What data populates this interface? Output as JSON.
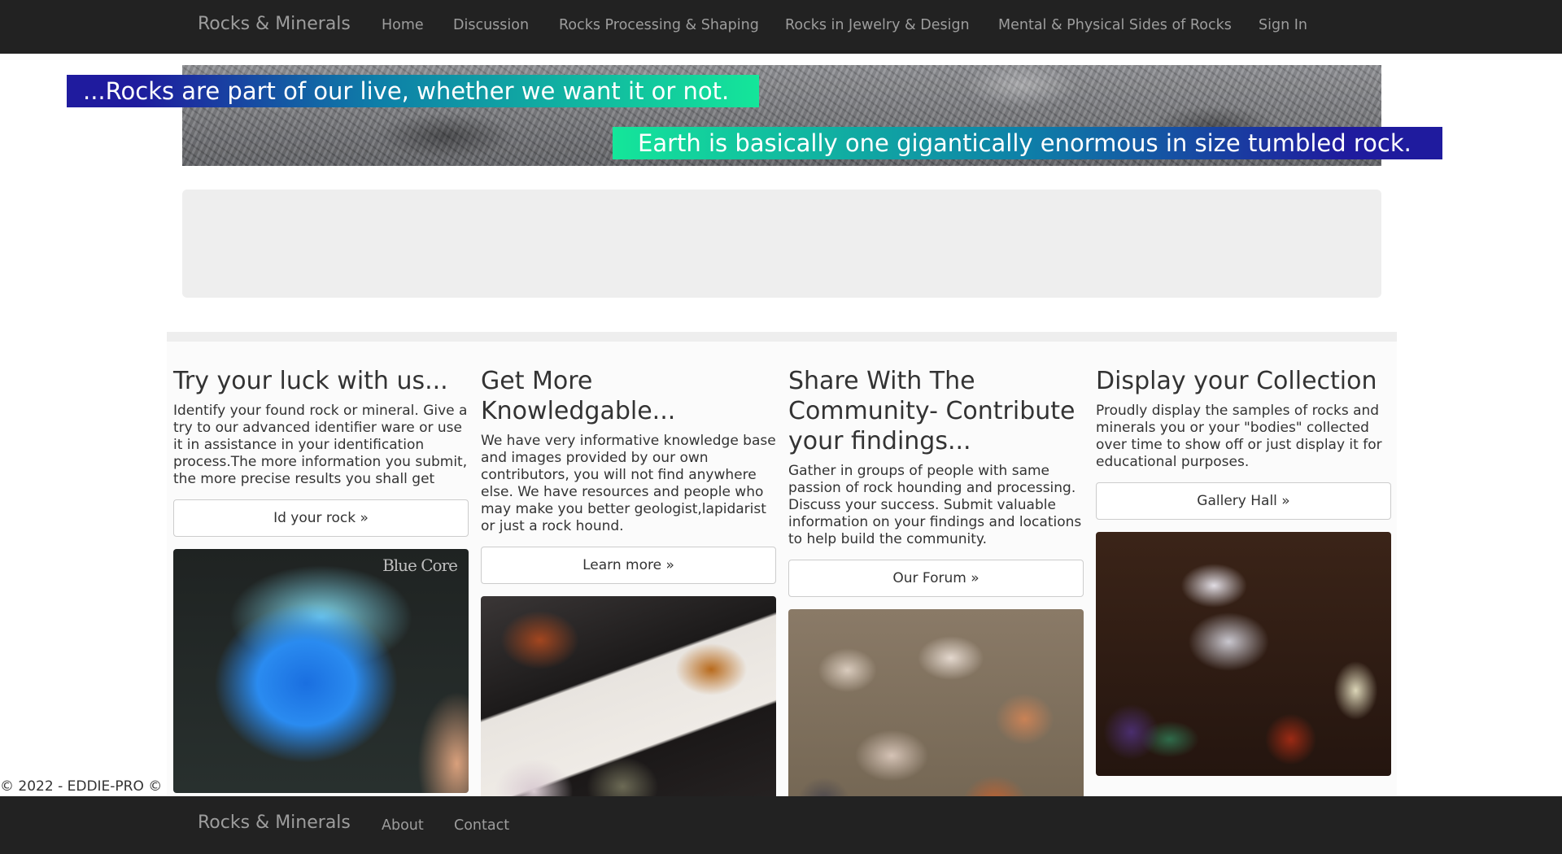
{
  "navbar": {
    "brand": "Rocks & Minerals",
    "links": [
      "Home",
      "Discussion",
      "Rocks Processing & Shaping",
      "Rocks in Jewelry & Design",
      "Mental & Physical Sides of Rocks",
      "Sign In"
    ]
  },
  "banner": {
    "line1": "...Rocks are part of our live, whether we want it or not.",
    "line2": "Earth is basically one gigantically enormous in size tumbled rock."
  },
  "cards": [
    {
      "title": "Try your luck with us...",
      "text": "Identify your found rock or mineral. Give a try to our advanced identifier ware or use it in assistance in your identification process.The more information you submit, the more precise results you shall get",
      "button": "Id your rock »",
      "image_watermark": "Blue Core"
    },
    {
      "title": "Get More Knowledgable...",
      "text": "We have very informative knowledge base and images provided by our own contributors, you will not find anywhere else. We have resources and people who may make you better geologist,lapidarist or just a rock hound.",
      "button": "Learn more »"
    },
    {
      "title": "Share With The Community- Contribute your findings...",
      "text": "Gather in groups of people with same passion of rock hounding and processing. Discuss your success. Submit valuable information on your findings and locations to help build the community.",
      "button": "Our Forum »"
    },
    {
      "title": "Display your Collection",
      "text": "Proudly display the samples of rocks and minerals you or your \"bodies\" collected over time to show off or just display it for educational purposes.",
      "button": "Gallery Hall »"
    }
  ],
  "copyright": "© 2022 - EDDIE-PRO ©",
  "footer": {
    "brand": "Rocks & Minerals",
    "links": [
      "About",
      "Contact"
    ]
  },
  "colors": {
    "navbar_bg": "#222222",
    "nav_text": "#9d9d9d",
    "panel_bg": "#eeeeee",
    "banner_gradient_blue": "#1f1b9e",
    "banner_gradient_green": "#14e69a"
  }
}
